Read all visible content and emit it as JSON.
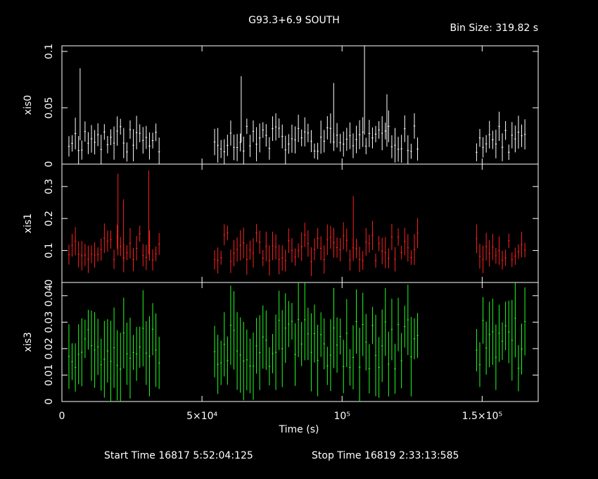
{
  "chart_data": {
    "type": "scatter",
    "title": "G93.3+6.9 SOUTH",
    "bin_size_label": "Bin Size: 319.82 s",
    "xlabel": "Time (s)",
    "xlim": [
      0,
      170000
    ],
    "x_ticks": [
      {
        "value": 0,
        "label": "0"
      },
      {
        "value": 50000,
        "label": "5×10⁴"
      },
      {
        "value": 100000,
        "label": "10⁵"
      },
      {
        "value": 150000,
        "label": "1.5×10⁵"
      }
    ],
    "footer": {
      "start": "Start Time 16817  5:52:04:125",
      "stop": "Stop Time 16819  2:33:13:585"
    },
    "panels": [
      {
        "name": "xis0",
        "ylabel": "xis0",
        "color": "#ffffff",
        "ylim": [
          0,
          0.105
        ],
        "y_ticks": [
          {
            "value": 0,
            "label": "0"
          },
          {
            "value": 0.05,
            "label": "0.05"
          },
          {
            "value": 0.1,
            "label": "0.1"
          }
        ],
        "seed": 11,
        "mean": 0.022,
        "spread": 0.012,
        "err": 0.011,
        "spikes": [
          [
            6500,
            0.085
          ],
          [
            64000,
            0.078
          ],
          [
            97000,
            0.072
          ],
          [
            108000,
            0.105
          ],
          [
            116000,
            0.062
          ]
        ]
      },
      {
        "name": "xis1",
        "ylabel": "xis1",
        "color": "#ff2020",
        "ylim": [
          0,
          0.37
        ],
        "y_ticks": [
          {
            "value": 0,
            "label": "0"
          },
          {
            "value": 0.1,
            "label": "0.1"
          },
          {
            "value": 0.2,
            "label": "0.2"
          },
          {
            "value": 0.3,
            "label": "0.3"
          }
        ],
        "seed": 23,
        "mean": 0.11,
        "spread": 0.045,
        "err": 0.035,
        "spikes": [
          [
            20000,
            0.34
          ],
          [
            31000,
            0.35
          ],
          [
            22000,
            0.26
          ],
          [
            104000,
            0.27
          ]
        ]
      },
      {
        "name": "xis3",
        "ylabel": "xis3",
        "color": "#20ff20",
        "ylim": [
          0,
          0.045
        ],
        "y_ticks": [
          {
            "value": 0,
            "label": "0"
          },
          {
            "value": 0.01,
            "label": "0.01"
          },
          {
            "value": 0.02,
            "label": "0.02"
          },
          {
            "value": 0.03,
            "label": "0.03"
          },
          {
            "value": 0.04,
            "label": "0.04"
          }
        ],
        "seed": 37,
        "mean": 0.022,
        "spread": 0.01,
        "err": 0.011,
        "spikes": []
      }
    ],
    "segments": [
      [
        2500,
        35500
      ],
      [
        54500,
        127500
      ],
      [
        148000,
        166000
      ]
    ],
    "bin_size_s": 319.82
  }
}
